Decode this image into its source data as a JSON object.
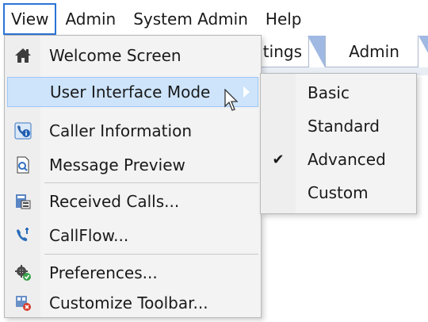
{
  "menubar": {
    "items": [
      {
        "label": "View"
      },
      {
        "label": "Admin"
      },
      {
        "label": "System Admin"
      },
      {
        "label": "Help"
      }
    ]
  },
  "tabs": [
    {
      "label": "tings"
    },
    {
      "label": "Admin"
    }
  ],
  "view_menu": {
    "items": [
      {
        "label": "Welcome Screen",
        "icon": "home-icon"
      },
      {
        "label": "User Interface Mode",
        "icon": "",
        "has_submenu": true,
        "highlighted": true
      },
      {
        "label": "Caller Information",
        "icon": "caller-info-icon"
      },
      {
        "label": "Message Preview",
        "icon": "message-preview-icon"
      },
      {
        "label": "Received Calls...",
        "icon": "received-calls-icon"
      },
      {
        "label": "CallFlow...",
        "icon": "callflow-icon"
      },
      {
        "label": "Preferences...",
        "icon": "preferences-gear-icon"
      },
      {
        "label": "Customize Toolbar...",
        "icon": "customize-toolbar-icon"
      }
    ]
  },
  "ui_mode_submenu": {
    "items": [
      {
        "label": "Basic",
        "checked": false
      },
      {
        "label": "Standard",
        "checked": false
      },
      {
        "label": "Advanced",
        "checked": true
      },
      {
        "label": "Custom",
        "checked": false
      }
    ],
    "check_glyph": "✔"
  },
  "colors": {
    "menu_bg": "#f3f3f3",
    "highlight": "#cde4fb",
    "active_border": "#2b74d6"
  }
}
